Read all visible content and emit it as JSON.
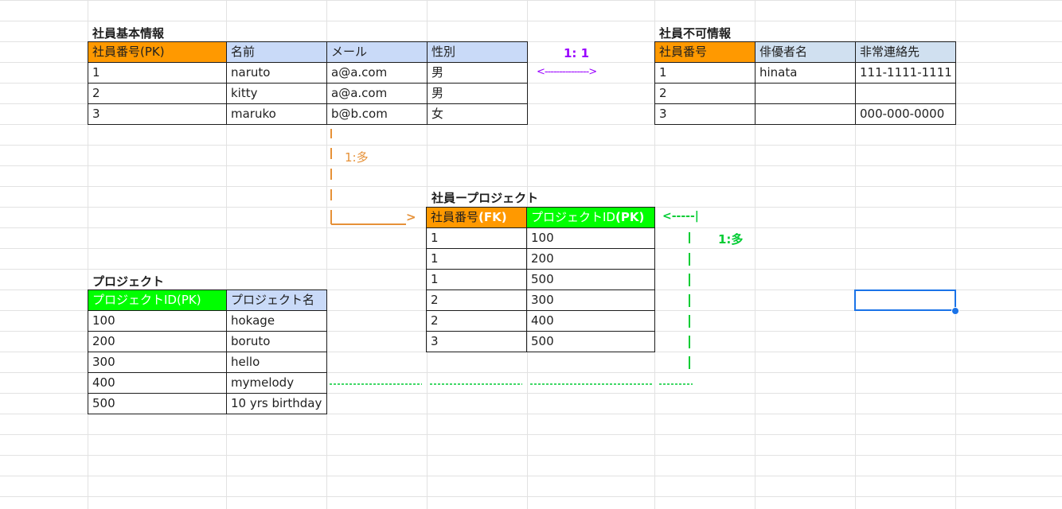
{
  "colors": {
    "pk_header": "#ff9900",
    "col_header": "#c9daf8",
    "project_pk_header": "#00ff00",
    "arrow_orange": "#e69138",
    "arrow_purple": "#9900ff",
    "arrow_green": "#00cc33",
    "selection": "#1a73e8"
  },
  "employee_basic": {
    "title": "社員基本情報",
    "headers": [
      "社員番号(PK)",
      "名前",
      "メール",
      "性別"
    ],
    "rows": [
      [
        "1",
        "naruto",
        "a@a.com",
        "男"
      ],
      [
        "2",
        "kitty",
        "a@a.com",
        "男"
      ],
      [
        "3",
        "maruko",
        "b@b.com",
        "女"
      ]
    ]
  },
  "employee_private": {
    "title": "社員不可情報",
    "headers": [
      "社員番号",
      "俳優者名",
      "非常連絡先"
    ],
    "rows": [
      [
        "1",
        "hinata",
        "111-1111-1111"
      ],
      [
        "2",
        "",
        ""
      ],
      [
        "3",
        "",
        "000-000-0000"
      ]
    ]
  },
  "employee_project": {
    "title": "社員ープロジェクト",
    "headers": [
      "社員番号",
      "(FK)",
      "プロジェクトID",
      "(PK)"
    ],
    "rows": [
      [
        "1",
        "100"
      ],
      [
        "1",
        "200"
      ],
      [
        "1",
        "500"
      ],
      [
        "2",
        "300"
      ],
      [
        "2",
        "400"
      ],
      [
        "3",
        "500"
      ]
    ]
  },
  "project": {
    "title": "プロジェクト",
    "headers": [
      "プロジェクトID(PK)",
      "プロジェクト名"
    ],
    "rows": [
      [
        "100",
        "hokage"
      ],
      [
        "200",
        "boruto"
      ],
      [
        "300",
        "hello"
      ],
      [
        "400",
        "mymelody"
      ],
      [
        "500",
        "10 yrs  birthday"
      ]
    ]
  },
  "annotations": {
    "one_to_one": "1: 1",
    "one_to_one_arrow": "<--------------->",
    "one_to_many_orange": "1:多",
    "orange_arrow_head": ">",
    "one_to_many_green": "1:多",
    "green_arrow_tip": "<-----|"
  }
}
